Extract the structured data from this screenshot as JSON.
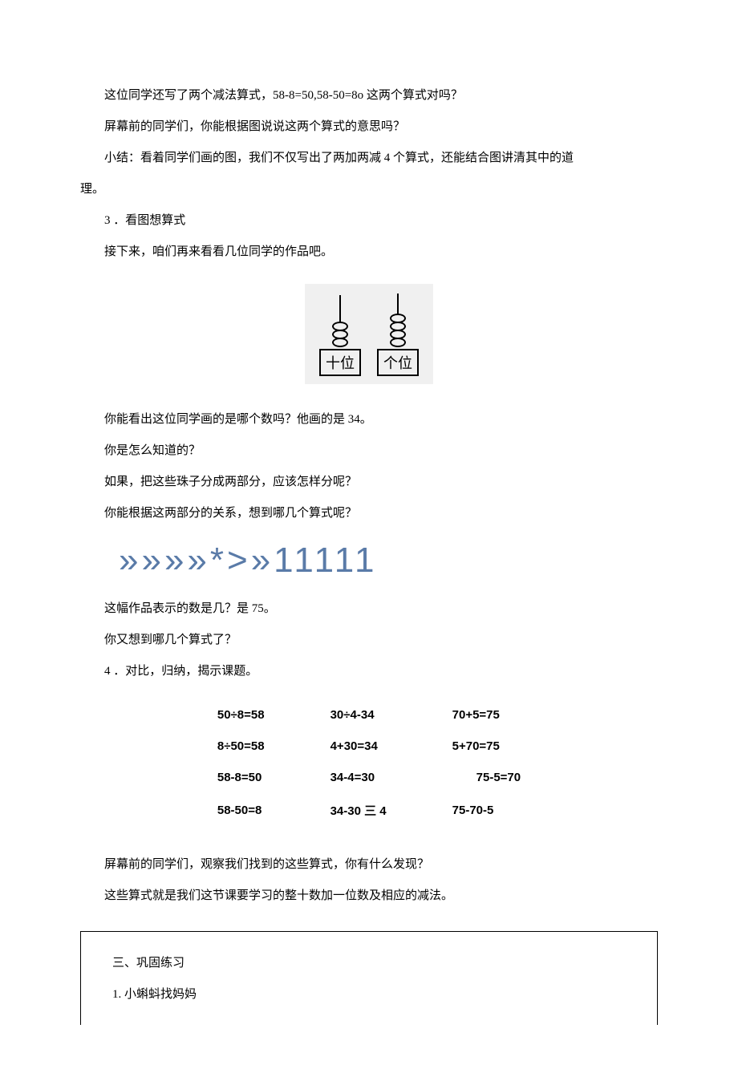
{
  "intro": {
    "p1": "这位同学还写了两个减法算式，58-8=50,58-50=8o 这两个算式对吗？",
    "p2": "屏幕前的同学们，你能根据图说说这两个算式的意思吗？",
    "p3_a": "小结：看着同学们画的图，我们不仅写出了两加两减 4 个算式，还能结合图讲清其中的道",
    "p3_b": "理。",
    "h3": "3 ．看图想算式",
    "p4": "接下来，咱们再来看看几位同学的作品吧。"
  },
  "abacus": {
    "left_label": "十位",
    "right_label": "个位",
    "left_beads": 3,
    "right_beads": 4
  },
  "mid": {
    "q1": "你能看出这位同学画的是哪个数吗？他画的是 34。",
    "q2": "你是怎么知道的？",
    "q3": "如果，把这些珠子分成两部分，应该怎样分呢？",
    "q4": "你能根据这两部分的关系，想到哪几个算式呢？"
  },
  "art_line": "»»»»*>»11111",
  "after_art": {
    "p1": "这幅作品表示的数是几？是 75。",
    "p2": "你又想到哪几个算式了？",
    "h4": "4  ．对比，归纳，揭示课题。"
  },
  "equations": {
    "rows": [
      [
        "50÷8=58",
        "30÷4-34",
        "70+5=75"
      ],
      [
        "8÷50=58",
        "4+30=34",
        "5+70=75"
      ],
      [
        "58-8=50",
        "34-4=30",
        "75-5=70"
      ],
      [
        "58-50=8",
        "34-30 三 4",
        "75-70-5"
      ]
    ]
  },
  "closing": {
    "p1": "屏幕前的同学们，观察我们找到的这些算式，你有什么发现？",
    "p2": "这些算式就是我们这节课要学习的整十数加一位数及相应的减法。"
  },
  "footer": {
    "h": "三、巩固练习",
    "item": "1. 小蝌蚪找妈妈"
  }
}
